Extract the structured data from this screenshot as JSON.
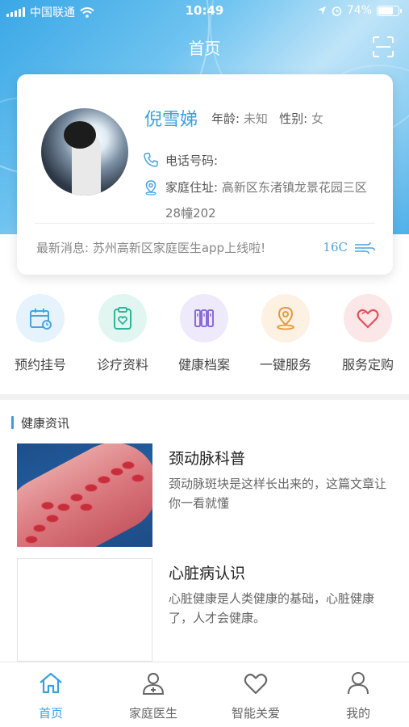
{
  "status": {
    "carrier": "中国联通",
    "time": "10:49",
    "battery": "74%",
    "battery_level": 0.74
  },
  "nav": {
    "title": "首页"
  },
  "profile": {
    "name": "倪雪娣",
    "age_label": "年龄:",
    "age_value": "未知",
    "gender_label": "性别:",
    "gender_value": "女",
    "phone_label": "电话号码:",
    "phone_value": "",
    "address_label": "家庭住址:",
    "address_value": "高新区东渚镇龙景花园三区28幢202"
  },
  "news_ticker": {
    "label": "最新消息:",
    "text": "苏州高新区家庭医生app上线啦!",
    "temperature": "16C"
  },
  "quick_actions": [
    {
      "label": "预约挂号",
      "icon": "calendar-icon",
      "color": "#4aa3e0",
      "bg": "#e6f3fc"
    },
    {
      "label": "诊疗资料",
      "icon": "clipboard-heart-icon",
      "color": "#2fb39a",
      "bg": "#e2f6f1"
    },
    {
      "label": "健康档案",
      "icon": "archive-icon",
      "color": "#8a6bd6",
      "bg": "#efeafb"
    },
    {
      "label": "一键服务",
      "icon": "location-pin-icon",
      "color": "#e59a3a",
      "bg": "#fdf1e3"
    },
    {
      "label": "服务定购",
      "icon": "heart-icon",
      "color": "#e0505a",
      "bg": "#fce7e8"
    }
  ],
  "section": {
    "title": "健康资讯"
  },
  "articles": [
    {
      "title": "颈动脉科普",
      "desc": "颈动脉斑块是这样长出来的，这篇文章让你一看就懂"
    },
    {
      "title": "心脏病认识",
      "desc": "心脏健康是人类健康的基础，心脏健康了，人才会健康。"
    }
  ],
  "tabs": [
    {
      "label": "首页",
      "icon": "home-icon",
      "active": true
    },
    {
      "label": "家庭医生",
      "icon": "doctor-icon",
      "active": false
    },
    {
      "label": "智能关爱",
      "icon": "heart-outline-icon",
      "active": false
    },
    {
      "label": "我的",
      "icon": "user-icon",
      "active": false
    }
  ],
  "colors": {
    "accent": "#3aa0dd",
    "text": "#333333",
    "muted": "#888888"
  }
}
